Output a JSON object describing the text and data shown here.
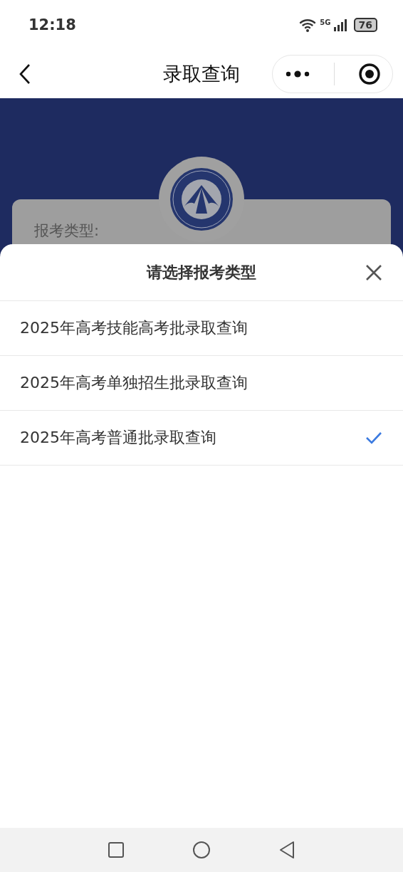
{
  "status_bar": {
    "time": "12:18",
    "network": "5G",
    "battery": "76"
  },
  "nav": {
    "title": "录取查询"
  },
  "form": {
    "field_label": "报考类型:"
  },
  "sheet": {
    "title": "请选择报考类型",
    "options": [
      {
        "label": "2025年高考技能高考批录取查询",
        "selected": false
      },
      {
        "label": "2025年高考单独招生批录取查询",
        "selected": false
      },
      {
        "label": "2025年高考普通批录取查询",
        "selected": true
      }
    ]
  }
}
